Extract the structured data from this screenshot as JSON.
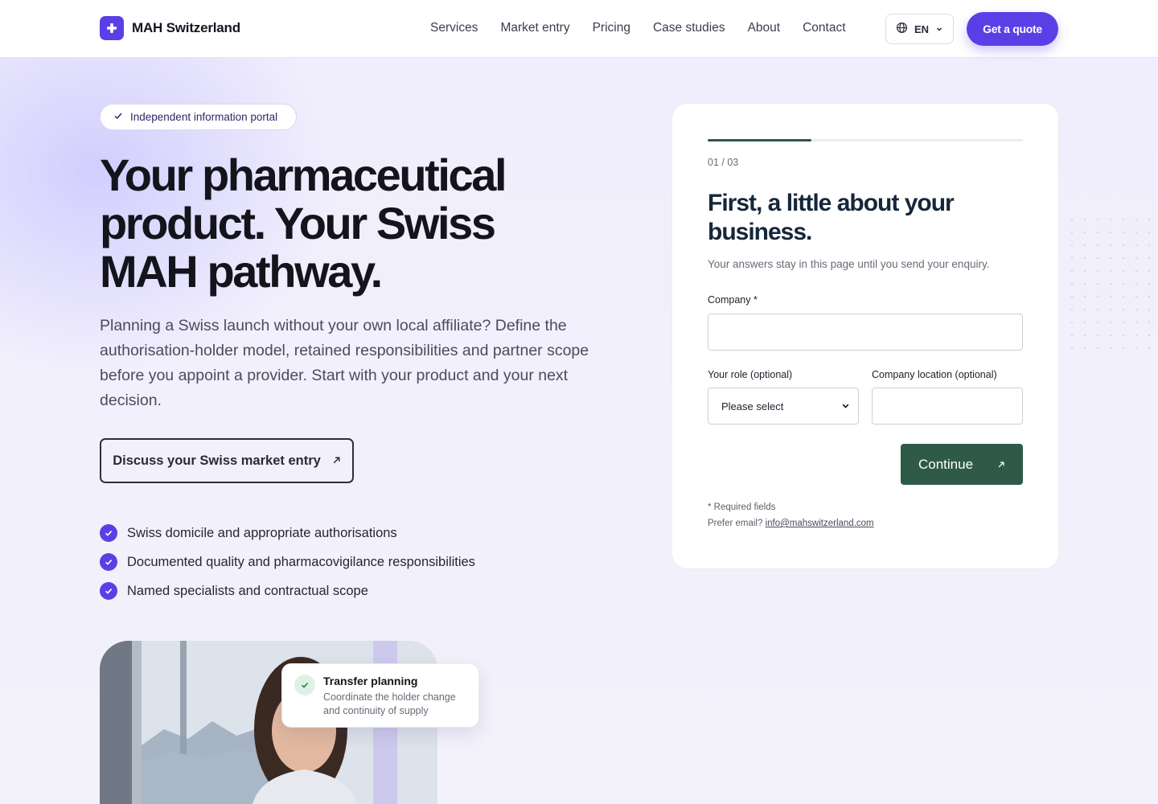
{
  "brand": {
    "name": "MAH Switzerland",
    "accent": "#5b3fe6",
    "green": "#2f5a48"
  },
  "nav": {
    "items": [
      {
        "label": "Services"
      },
      {
        "label": "Market entry"
      },
      {
        "label": "Pricing"
      },
      {
        "label": "Case studies"
      },
      {
        "label": "About"
      },
      {
        "label": "Contact"
      }
    ],
    "language": "EN",
    "cta": "Get a quote"
  },
  "hero": {
    "badge": "Independent information portal",
    "title": "Your pharmaceutical product. Your Swiss MAH pathway.",
    "lead": "Planning a Swiss launch without your own local affiliate? Define the authorisation-holder model, retained responsibilities and partner scope before you appoint a provider. Start with your product and your next decision.",
    "cta": "Discuss your Swiss market entry",
    "checks": [
      {
        "text": "Swiss domicile and appropriate authorisations"
      },
      {
        "text": "Documented quality and pharmacovigilance responsibilities"
      },
      {
        "text": "Named specialists and contractual scope"
      }
    ],
    "card": {
      "title": "Transfer planning",
      "subtitle": "Coordinate the holder change and continuity of supply"
    }
  },
  "form": {
    "progress": 0.33,
    "step": "01 / 03",
    "title": "First, a little about your business.",
    "subtitle": "Your answers stay in this page until you send your enquiry.",
    "company_label": "Company *",
    "company_value": "",
    "role_label": "Your role (optional)",
    "role_value": "Please select",
    "location_label": "Company location (optional)",
    "location_value": "",
    "continue": "Continue",
    "required_note": "* Required fields",
    "prefer_email": "Prefer email?",
    "email": "info@mahswitzerland.com"
  }
}
